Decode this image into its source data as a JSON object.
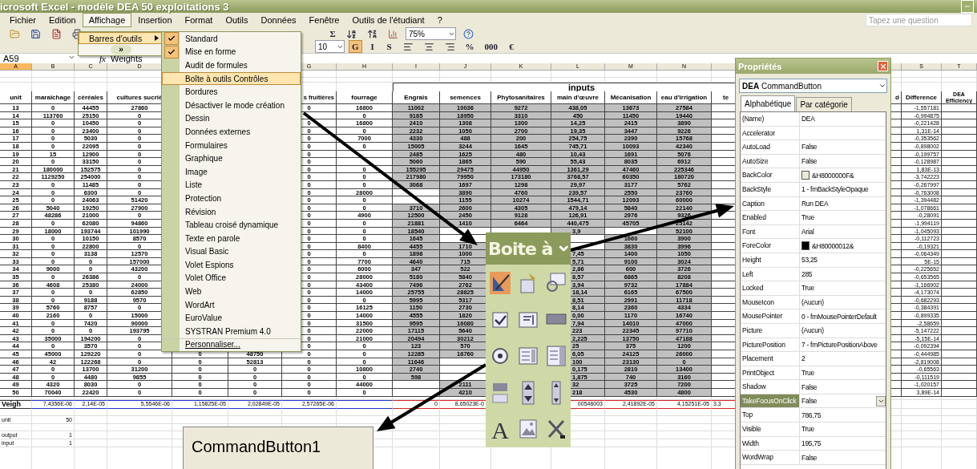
{
  "window": {
    "title": "icrosoft Excel - modèle DEA 50 exploitations 3"
  },
  "menu_bar": [
    {
      "label": "Fichier",
      "selected": false
    },
    {
      "label": "Edition",
      "selected": false
    },
    {
      "label": "Affichage",
      "selected": true
    },
    {
      "label": "Insertion",
      "selected": false
    },
    {
      "label": "Format",
      "selected": false
    },
    {
      "label": "Outils",
      "selected": false
    },
    {
      "label": "Données",
      "selected": false
    },
    {
      "label": "Fenêtre",
      "selected": false
    },
    {
      "label": "Outils de l'étudiant",
      "selected": false
    },
    {
      "label": "?",
      "selected": false
    }
  ],
  "help_search": {
    "placeholder": "Tapez une question"
  },
  "toolbar": {
    "sum": "Σ",
    "zoom": "75%",
    "font_size": "10",
    "format_buttons": [
      {
        "label": "G",
        "selected": true
      },
      {
        "label": "I",
        "selected": false
      },
      {
        "label": "S",
        "selected": false
      }
    ],
    "number_buttons": [
      "%",
      "000",
      "€"
    ]
  },
  "formula_bar": {
    "name_box": "A59",
    "fx": "fx",
    "value": "Weights"
  },
  "sheet": {
    "column_letters": {
      "A": "A",
      "B": "B",
      "C": "C",
      "D": "D",
      "G": "G",
      "H": "H",
      "I": "I",
      "J": "J",
      "K": "K",
      "L": "L",
      "M": "M",
      "N": "N",
      "S": "S",
      "T": "T"
    },
    "group_header": "inputs",
    "headers": {
      "A": "unit",
      "B": "maraîchage",
      "C": "céréales",
      "D": "cultures sucriè",
      "G": "s fruitières",
      "H": "fourrage",
      "I": "Engrais",
      "J": "semences",
      "K": "Phytosanitaires",
      "L": "main d'œuvre",
      "M": "Mécanisation",
      "N": "eau d'irrigation",
      "O": "te",
      "R": "d",
      "S": "Difference",
      "T": "DEA Efficiency"
    },
    "rows": [
      {
        "A": "13",
        "B": "0",
        "C": "44455",
        "D": "27860",
        "G": "0",
        "H": "16800",
        "I": "11002",
        "J": "10036",
        "K": "9272",
        "L": "438,05",
        "M": "13673",
        "N": "27584",
        "S": "-1,557181"
      },
      {
        "A": "14",
        "B": "113760",
        "C": "25150",
        "D": "0",
        "H": "0",
        "I": "9165",
        "J": "18950",
        "K": "3310",
        "L": "450",
        "M": "11450",
        "N": "19440",
        "S": "-0,994875"
      },
      {
        "A": "15",
        "B": "0",
        "C": "10450",
        "D": "0",
        "G": "0",
        "H": "16800",
        "I": "2410",
        "J": "1308",
        "K": "1300",
        "L": "14,25",
        "M": "2415",
        "N": "3890",
        "S": "-0,221428"
      },
      {
        "A": "16",
        "B": "0",
        "C": "23400",
        "D": "0",
        "G": "0",
        "H": "0",
        "I": "2232",
        "J": "1050",
        "K": "2700",
        "L": "19,35",
        "M": "3447",
        "N": "9226",
        "S": "1,31E-14"
      },
      {
        "A": "17",
        "B": "0",
        "C": "5030",
        "D": "0",
        "G": "0",
        "H": "7000",
        "I": "4330",
        "J": "488",
        "K": "200",
        "L": "254,75",
        "M": "2390",
        "N": "15768",
        "S": "-0,353562"
      },
      {
        "A": "18",
        "B": "0",
        "C": "22095",
        "D": "0",
        "G": "0",
        "H": "0",
        "I": "15005",
        "J": "3244",
        "K": "1645",
        "L": "745,71",
        "M": "10093",
        "N": "42340",
        "S": "-0,898002"
      },
      {
        "A": "19",
        "B": "15",
        "C": "12900",
        "D": "0",
        "G": "0",
        "I": "2485",
        "J": "1625",
        "K": "480",
        "L": "10,43",
        "M": "1691",
        "N": "5076",
        "S": "-0,199757"
      },
      {
        "A": "20",
        "B": "0",
        "C": "33150",
        "D": "0",
        "G": "0",
        "I": "5060",
        "J": "1865",
        "K": "590",
        "L": "55,43",
        "M": "8035",
        "N": "6912",
        "S": "-0,128987"
      },
      {
        "A": "21",
        "B": "180000",
        "C": "152575",
        "D": "0",
        "G": "0",
        "H": "0",
        "I": "155295",
        "J": "29475",
        "K": "44950",
        "L": "1361,29",
        "M": "47460",
        "N": "225346",
        "S": "1,83E-13"
      },
      {
        "A": "22",
        "B": "1129250",
        "C": "254000",
        "D": "0",
        "G": "0",
        "H": "0",
        "I": "217980",
        "J": "79950",
        "K": "173180",
        "L": "3768,57",
        "M": "60350",
        "N": "180720",
        "S": "-3,742223"
      },
      {
        "A": "23",
        "B": "0",
        "C": "11485",
        "D": "0",
        "G": "0",
        "H": "0",
        "I": "3068",
        "J": "1697",
        "K": "1298",
        "L": "29,97",
        "M": "3177",
        "N": "5762",
        "S": "-0,267997"
      },
      {
        "A": "24",
        "B": "0",
        "C": "6300",
        "D": "0",
        "G": "0",
        "H": "28000",
        "J": "3890",
        "K": "4760",
        "L": "239,57",
        "M": "2550",
        "N": "23760",
        "S": "-0,763008"
      },
      {
        "A": "25",
        "B": "0",
        "C": "24063",
        "D": "51420",
        "G": "0",
        "H": "0",
        "J": "1155",
        "K": "10274",
        "L": "1544,71",
        "M": "12093",
        "N": "60000",
        "S": "-1,394482"
      },
      {
        "A": "26",
        "B": "5040",
        "C": "19250",
        "D": "27900",
        "G": "0",
        "H": "0",
        "I": "3710",
        "J": "2600",
        "K": "4305",
        "L": "479,14",
        "M": "5840",
        "N": "22140",
        "S": "-1,078661"
      },
      {
        "A": "27",
        "B": "48286",
        "C": "21000",
        "D": "0",
        "G": "0",
        "H": "4900",
        "I": "12500",
        "J": "2450",
        "K": "9128",
        "L": "126,91",
        "M": "2976",
        "N": "9326",
        "S": "-0,28091"
      },
      {
        "A": "28",
        "B": "0",
        "C": "62080",
        "D": "94860",
        "G": "0",
        "H": "0",
        "I": "21881",
        "J": "1410",
        "K": "6464",
        "L": "440,475",
        "M": "45705",
        "N": "25142",
        "S": "-1,994119"
      },
      {
        "A": "29",
        "B": "18000",
        "C": "193744",
        "D": "101990",
        "G": "0",
        "H": "0",
        "I": "18540",
        "L": "3,9",
        "N": "52100",
        "S": "-1,045093"
      },
      {
        "A": "30",
        "B": "0",
        "C": "10150",
        "D": "8570",
        "G": "0",
        "H": "0",
        "I": "1645",
        "M": "1660",
        "N": "3900",
        "S": "-0,112723"
      },
      {
        "A": "31",
        "B": "0",
        "C": "22800",
        "D": "0",
        "G": "0",
        "H": "8400",
        "I": "4455",
        "J": "1710",
        "M": "3830",
        "N": "3996",
        "S": "-0,19321"
      },
      {
        "A": "32",
        "B": "0",
        "C": "3138",
        "D": "12570",
        "G": "0",
        "H": "0",
        "I": "1898",
        "J": "1000",
        "L": "7,45",
        "M": "1400",
        "N": "1050",
        "S": "-0,064349"
      },
      {
        "A": "33",
        "B": "0",
        "C": "0",
        "D": "157000",
        "G": "0",
        "H": "7700",
        "I": "4640",
        "J": "715",
        "L": "5,71",
        "M": "9100",
        "N": "3024",
        "S": "5E-15"
      },
      {
        "A": "34",
        "B": "9000",
        "C": "0",
        "D": "43200",
        "G": "0",
        "H": "6000",
        "I": "347",
        "J": "522",
        "L": "2,86",
        "M": "600",
        "N": "3726",
        "S": "-0,225652"
      },
      {
        "A": "35",
        "B": "0",
        "C": "26386",
        "D": "0",
        "G": "0",
        "H": "28000",
        "I": "5180",
        "J": "5840",
        "L": "8,57",
        "M": "6865",
        "N": "8208",
        "S": "-0,653565"
      },
      {
        "A": "36",
        "B": "4608",
        "C": "25380",
        "D": "24000",
        "G": "0",
        "H": "43400",
        "I": "7496",
        "J": "2762",
        "L": "3,94",
        "M": "9732",
        "N": "17884",
        "S": "-1,166902"
      },
      {
        "A": "37",
        "B": "0",
        "C": "0",
        "D": "62850",
        "G": "0",
        "H": "14000",
        "I": "25755",
        "J": "28825",
        "L": "18,14",
        "M": "6165",
        "N": "67500",
        "S": "-4,173074"
      },
      {
        "A": "38",
        "B": "0",
        "C": "9188",
        "D": "9570",
        "G": "0",
        "H": "0",
        "I": "5995",
        "J": "5317",
        "L": "8,51",
        "M": "2991",
        "N": "11718",
        "S": "-0,682293"
      },
      {
        "A": "39",
        "B": "5760",
        "C": "8757",
        "D": "0",
        "G": "0",
        "H": "16125",
        "I": "1150",
        "J": "2730",
        "L": "8,14",
        "M": "2360",
        "N": "4334",
        "S": "-0,384391"
      },
      {
        "A": "40",
        "B": "2160",
        "C": "0",
        "D": "15000",
        "G": "0",
        "H": "14000",
        "I": "4555",
        "J": "1820",
        "L": "0,00",
        "M": "1170",
        "N": "16740",
        "S": "-0,899335"
      },
      {
        "A": "41",
        "B": "0",
        "C": "7420",
        "D": "90000",
        "G": "0",
        "H": "31500",
        "I": "9595",
        "J": "16080",
        "L": "7,94",
        "M": "14010",
        "N": "47000",
        "S": "-2,58659"
      },
      {
        "A": "42",
        "B": "0",
        "C": "0",
        "D": "193795",
        "G": "0",
        "H": "22000",
        "I": "17115",
        "J": "5640",
        "L": "223",
        "M": "22345",
        "N": "97710",
        "S": "-5,147222"
      },
      {
        "A": "43",
        "B": "35000",
        "C": "194200",
        "D": "0",
        "G": "0",
        "H": "21000",
        "I": "20494",
        "J": "30212",
        "L": "2,225",
        "M": "13750",
        "N": "47188",
        "S": "-5,15E-14"
      },
      {
        "A": "44",
        "B": "0",
        "C": "3570",
        "D": "0",
        "G": "0",
        "H": "0",
        "I": "123",
        "J": "570",
        "L": "25",
        "M": "375",
        "N": "1200",
        "S": "-0,092394"
      },
      {
        "A": "45",
        "B": "45000",
        "C": "129220",
        "D": "0",
        "E": "0",
        "F": "48750",
        "G": "0",
        "H": "0",
        "I": "12285",
        "J": "16760",
        "L": "6,05",
        "M": "24125",
        "N": "26000",
        "S": "-0,444985"
      },
      {
        "A": "46",
        "B": "42",
        "C": "122268",
        "D": "0",
        "E": "0",
        "F": "52813",
        "G": "0",
        "H": "0",
        "I": "11646",
        "L": "100",
        "M": "23130",
        "N": "0",
        "S": "-2,819008"
      },
      {
        "A": "47",
        "B": "0",
        "C": "13700",
        "D": "31200",
        "E": "0",
        "F": "0",
        "G": "0",
        "H": "10800",
        "I": "2740",
        "L": "0,175",
        "M": "2810",
        "N": "13400",
        "S": "-0,65563"
      },
      {
        "A": "48",
        "B": "0",
        "C": "4480",
        "D": "9855",
        "E": "0",
        "F": "0",
        "G": "0",
        "H": "0",
        "I": "598",
        "L": "1,875",
        "M": "740",
        "N": "3160",
        "S": "-0,111519"
      },
      {
        "A": "49",
        "B": "4320",
        "C": "8030",
        "D": "0",
        "E": "0",
        "F": "0",
        "G": "0",
        "H": "44000",
        "J": "2111",
        "L": "32",
        "M": "3725",
        "N": "7200",
        "S": "-1,020157"
      },
      {
        "A": "50",
        "B": "70040",
        "C": "22420",
        "D": "0",
        "E": "0",
        "F": "0",
        "G": "0",
        "H": "0",
        "J": "4210",
        "L": "218",
        "M": "4530",
        "N": "4800",
        "S": "3,89E-14"
      }
    ],
    "weights": {
      "A": "Veigh",
      "B": "7,4356E-06",
      "C": "2,14E-05",
      "D": "5,5546E-06",
      "E": "1,15825E-05",
      "F": "2,02849E-05",
      "G": "2,57265E-06",
      "I": "0",
      "J": "8,65023E-0",
      "L": "00546003",
      "M": "2,41892E-05",
      "N": "4,15251E-05",
      "O": "3,3"
    },
    "footer_rows": [
      {
        "A": "unit",
        "B": "50"
      },
      {
        "A": "output",
        "B": "1"
      },
      {
        "A": "input",
        "B": "1"
      }
    ]
  },
  "view_menu": {
    "items": [
      {
        "label": "Barres d'outils",
        "selected": true
      }
    ],
    "more": "»"
  },
  "toolbars_submenu": {
    "items": [
      {
        "label": "Standard",
        "checked": true,
        "selected": false
      },
      {
        "label": "Mise en forme",
        "checked": true,
        "selected": false
      },
      {
        "label": "Audit de formules",
        "checked": false,
        "selected": false
      },
      {
        "label": "Boîte à outils Contrôles",
        "checked": false,
        "selected": true
      },
      {
        "label": "Bordures",
        "checked": false,
        "selected": false
      },
      {
        "label": "Désactiver le mode création",
        "checked": false,
        "selected": false
      },
      {
        "label": "Dessin",
        "checked": false,
        "selected": false
      },
      {
        "label": "Données externes",
        "checked": false,
        "selected": false
      },
      {
        "label": "Formulaires",
        "checked": false,
        "selected": false
      },
      {
        "label": "Graphique",
        "checked": false,
        "selected": false
      },
      {
        "label": "Image",
        "checked": false,
        "selected": false
      },
      {
        "label": "Liste",
        "checked": false,
        "selected": false
      },
      {
        "label": "Protection",
        "checked": false,
        "selected": false
      },
      {
        "label": "Révision",
        "checked": false,
        "selected": false
      },
      {
        "label": "Tableau croisé dynamique",
        "checked": false,
        "selected": false
      },
      {
        "label": "Texte en parole",
        "checked": false,
        "selected": false
      },
      {
        "label": "Visual Basic",
        "checked": false,
        "selected": false
      },
      {
        "label": "Volet Espions",
        "checked": false,
        "selected": false
      },
      {
        "label": "Volet Office",
        "checked": false,
        "selected": false
      },
      {
        "label": "Web",
        "checked": false,
        "selected": false
      },
      {
        "label": "WordArt",
        "checked": false,
        "selected": false
      },
      {
        "label": "EuroValue",
        "checked": false,
        "selected": false
      },
      {
        "label": "SYSTRAN Premium 4.0",
        "checked": false,
        "selected": false
      },
      {
        "label": "Personnaliser...",
        "checked": false,
        "selected": false,
        "kind": "customize"
      }
    ]
  },
  "toolbox": {
    "title": "Boite à",
    "label_glyph": "A"
  },
  "properties": {
    "title": "Propriétés",
    "object_name": "DEA",
    "object_type": "CommandButton",
    "tabs": [
      {
        "label": "Alphabétique",
        "selected": true
      },
      {
        "label": "Par catégorie",
        "selected": false
      }
    ],
    "rows": [
      {
        "name": "(Name)",
        "value": "DEA",
        "selected": false
      },
      {
        "name": "Accelerator",
        "selected": false
      },
      {
        "name": "AutoLoad",
        "value": "False",
        "selected": false
      },
      {
        "name": "AutoSize",
        "value": "False",
        "selected": false
      },
      {
        "name": "BackColor",
        "value": "&H8000000F&",
        "color": "#ece9d8",
        "selected": false
      },
      {
        "name": "BackStyle",
        "value": "1 - fmBackStyleOpaque",
        "selected": false
      },
      {
        "name": "Caption",
        "value": "Run DEA",
        "selected": false
      },
      {
        "name": "Enabled",
        "value": "True",
        "selected": false
      },
      {
        "name": "Font",
        "value": "Arial",
        "selected": false
      },
      {
        "name": "ForeColor",
        "value": "&H80000012&",
        "color": "#000000",
        "selected": false
      },
      {
        "name": "Height",
        "value": "53,25",
        "selected": false
      },
      {
        "name": "Left",
        "value": "285",
        "selected": false
      },
      {
        "name": "Locked",
        "value": "True",
        "selected": false
      },
      {
        "name": "MouseIcon",
        "value": "(Aucun)",
        "selected": false
      },
      {
        "name": "MousePointer",
        "value": "0 - fmMousePointerDefault",
        "selected": false
      },
      {
        "name": "Picture",
        "value": "(Aucun)",
        "selected": false
      },
      {
        "name": "PicturePosition",
        "value": "7 - fmPicturePositionAbove",
        "selected": false
      },
      {
        "name": "Placement",
        "value": "2",
        "selected": false
      },
      {
        "name": "PrintObject",
        "value": "True",
        "selected": false
      },
      {
        "name": "Shadow",
        "value": "False",
        "selected": false
      },
      {
        "name": "TakeFocusOnClick",
        "value": "False",
        "selected": true
      },
      {
        "name": "Top",
        "value": "786,75",
        "selected": false
      },
      {
        "name": "Visible",
        "value": "True",
        "selected": false
      },
      {
        "name": "Width",
        "value": "195,75",
        "selected": false
      },
      {
        "name": "WordWrap",
        "value": "False",
        "selected": false
      }
    ]
  },
  "command_button": {
    "caption": "CommandButton1"
  }
}
